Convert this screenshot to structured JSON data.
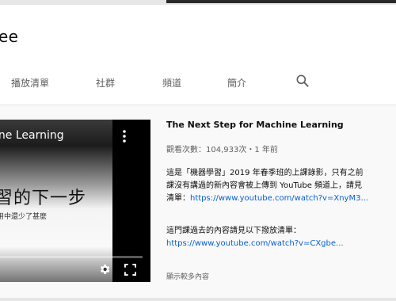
{
  "channel": {
    "name": "ee"
  },
  "tabs": [
    {
      "label": "播放清單"
    },
    {
      "label": "社群"
    },
    {
      "label": "頻道"
    },
    {
      "label": "簡介"
    }
  ],
  "search": {
    "icon": "search-icon"
  },
  "player": {
    "title_overlay": "ine Learning",
    "slide_big": "習的下一步",
    "slide_small": "用中還少了甚麼",
    "icons": [
      "more-vert-icon",
      "gear-icon",
      "fullscreen-icon"
    ]
  },
  "video": {
    "title": "The Next Step for Machine Learning",
    "meta": "觀看次數：104,933次・1 年前",
    "desc_line1": "這是「機器學習」2019 年春季班的上課錄影，只有之前",
    "desc_line2": "課沒有講過的新內容會被上傳到 YouTube 頻道上，請見",
    "desc_line3_prefix": "清單：",
    "desc_link1": "https://www.youtube.com/watch?v=XnyM3...",
    "desc2_line1": "這門課過去的內容請見以下撥放清單：",
    "desc_link2": "https://www.youtube.com/watch?v=CXgbe...",
    "show_more": "顯示較多內容"
  },
  "colors": {
    "link": "#065fd4",
    "muted": "#606060"
  }
}
